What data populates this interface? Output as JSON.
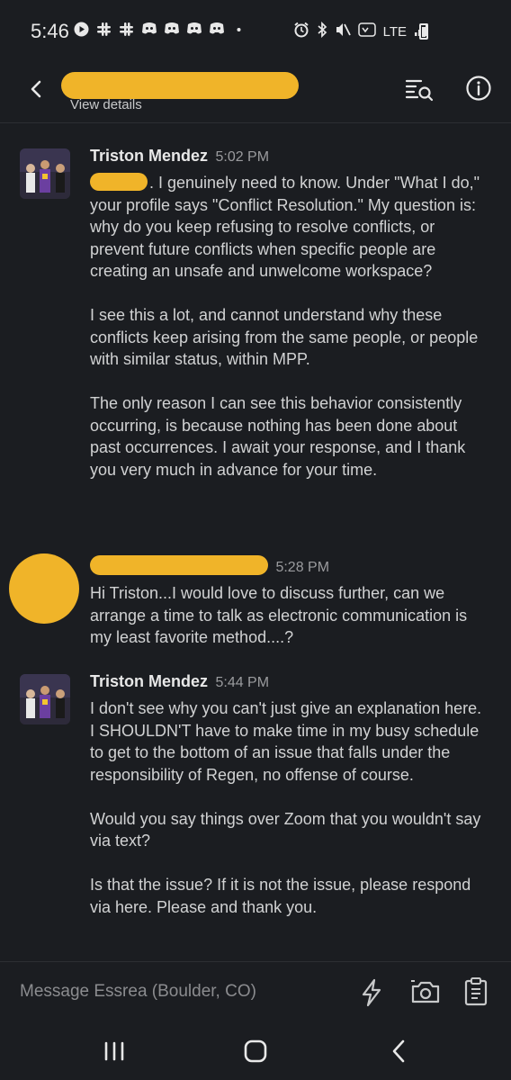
{
  "status_bar": {
    "time": "5:46",
    "network": "LTE",
    "left_icons": [
      "play-icon",
      "slack-icon",
      "slack-icon",
      "discord-icon",
      "discord-icon",
      "discord-icon",
      "discord-icon",
      "dot-icon"
    ],
    "right_icons": [
      "alarm-icon",
      "bluetooth-icon",
      "mute-icon",
      "volte-icon",
      "signal-icon",
      "battery-icon"
    ]
  },
  "header": {
    "subtitle": "View details"
  },
  "messages": [
    {
      "author": "Triston Mendez",
      "time": "5:02 PM",
      "paragraphs": [
        ". I genuinely need to know. Under \"What I do,\" your profile says \"Conflict Resolution.\" My question is: why do you keep refusing to resolve conflicts, or prevent future conflicts when specific people are creating an unsafe and unwelcome workspace?",
        "I see this a lot, and cannot understand why these conflicts keep arising from the same people, or people with similar status, within MPP.",
        "The only reason I can see this behavior consistently occurring, is because nothing has been done about past occurrences. I await your response, and I thank you very much in advance for your time."
      ]
    },
    {
      "author": "",
      "time": "5:28 PM",
      "paragraphs": [
        "Hi Triston...I would love to discuss further, can we arrange a time to talk as electronic communication is my least favorite method....?"
      ]
    },
    {
      "author": "Triston Mendez",
      "time": "5:44 PM",
      "paragraphs": [
        "I don't see why you can't just give an explanation here. I SHOULDN'T have to make time in my busy schedule to get to the bottom of an issue that falls under the responsibility of Regen, no offense of course.",
        "Would you say things over Zoom that you wouldn't say via text?",
        "Is that the issue? If it is not the issue, please respond via here. Please and thank you."
      ]
    }
  ],
  "composer": {
    "placeholder": "Message Essrea (Boulder, CO)"
  },
  "colors": {
    "background": "#1b1d21",
    "redaction": "#f0b429",
    "text": "#d1d2d3"
  }
}
